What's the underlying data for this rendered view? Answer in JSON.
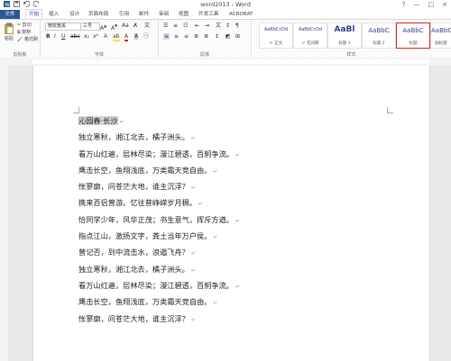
{
  "window": {
    "title": "word2013 - Word",
    "controls": [
      "?",
      "—",
      "□",
      "×"
    ]
  },
  "tabs": [
    {
      "label": "文件"
    },
    {
      "label": "开始"
    },
    {
      "label": "插入"
    },
    {
      "label": "设计"
    },
    {
      "label": "页面布局"
    },
    {
      "label": "引用"
    },
    {
      "label": "邮件"
    },
    {
      "label": "审阅"
    },
    {
      "label": "视图"
    },
    {
      "label": "开发工具"
    },
    {
      "label": "ACROBAT"
    }
  ],
  "ribbon": {
    "clipboard": {
      "paste_label": "粘贴",
      "cut_label": "剪切",
      "copy_label": "复制",
      "format_painter_label": "格式刷",
      "group_label": "剪贴板"
    },
    "font": {
      "font_name": "微软雅黑",
      "font_size": "三号",
      "group_label": "字体"
    },
    "paragraph": {
      "group_label": "段落"
    },
    "styles": {
      "group_label": "样式",
      "items": [
        {
          "preview": "AaBbCcDd",
          "name": "↵ 正文"
        },
        {
          "preview": "AaBbCcDd",
          "name": "↵ 无间隔"
        },
        {
          "preview": "AaBl",
          "name": "标题 1"
        },
        {
          "preview": "AaBbC",
          "name": "标题 2"
        },
        {
          "preview": "AaBbC",
          "name": "标题"
        },
        {
          "preview": "AaBbC",
          "name": "副标题"
        }
      ]
    }
  },
  "document": {
    "lines": [
      "沁园春·长沙",
      "独立寒秋，湘江北去，橘子洲头。",
      "看万山红遍，层林尽染；漫江碧透，百舸争流。",
      "鹰击长空，鱼翔浅底，万类霜天竞自由。",
      "怅寥廓，问苍茫大地，谁主沉浮？",
      "携来百侣曾游。忆往昔峥嵘岁月稠。",
      "恰同学少年，风华正茂；书生意气，挥斥方遒。",
      "指点江山，激扬文字，粪土当年万户侯。",
      "曾记否，到中流击水，浪遏飞舟？",
      "独立寒秋，湘江北去，橘子洲头。",
      "看万山红遍，层林尽染；漫江碧透，百舸争流。",
      "鹰击长空，鱼翔浅底，万类霜天竞自由。",
      "怅寥廓，问苍茫大地，谁主沉浮？"
    ],
    "paragraph_mark": "↵"
  },
  "colors": {
    "file_tab": "#2b579a",
    "selection_highlight": "#d4d4d4",
    "style_selected_border": "#e02020"
  }
}
